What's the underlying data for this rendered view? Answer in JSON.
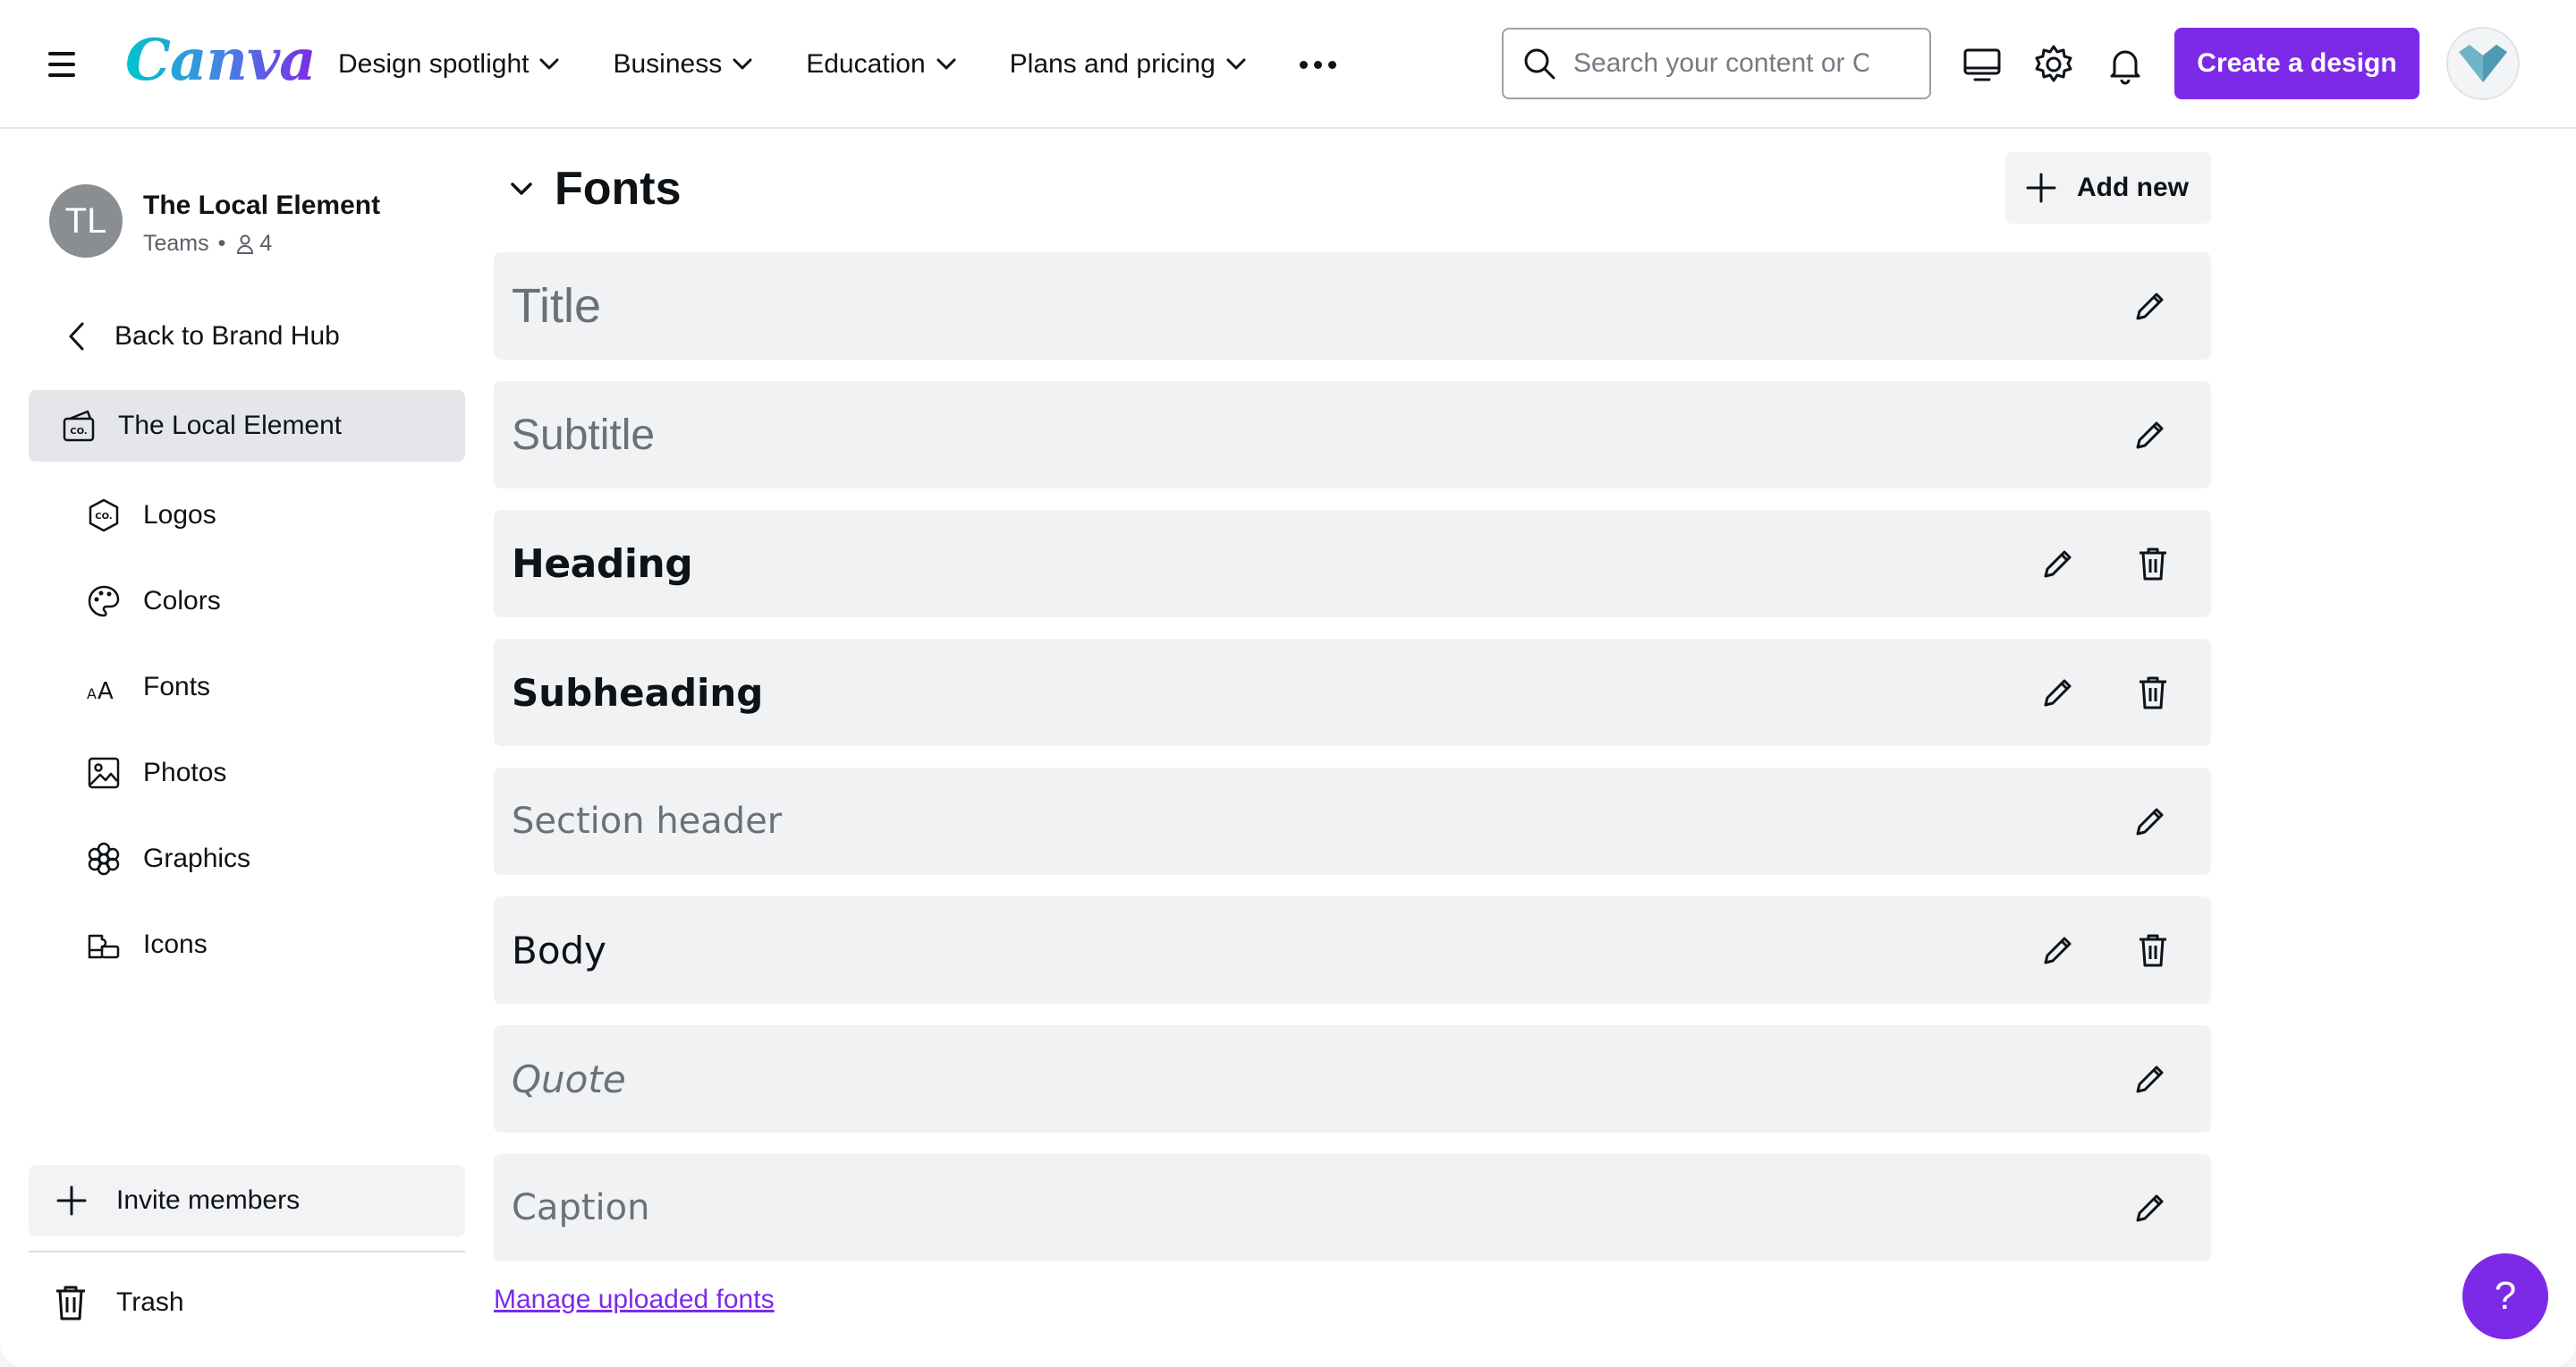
{
  "header": {
    "logo_text": "Canva",
    "nav": [
      {
        "label": "Design spotlight"
      },
      {
        "label": "Business"
      },
      {
        "label": "Education"
      },
      {
        "label": "Plans and pricing"
      }
    ],
    "search_placeholder": "Search your content or Canva's",
    "create_label": "Create a design"
  },
  "sidebar": {
    "team": {
      "initials": "TL",
      "name": "The Local Element",
      "type": "Teams",
      "members": "4"
    },
    "back_label": "Back to Brand Hub",
    "brand_label": "The Local Element",
    "items": [
      {
        "label": "Logos",
        "icon": "logo-badge-icon"
      },
      {
        "label": "Colors",
        "icon": "palette-icon"
      },
      {
        "label": "Fonts",
        "icon": "font-icon"
      },
      {
        "label": "Photos",
        "icon": "photo-icon"
      },
      {
        "label": "Graphics",
        "icon": "flower-icon"
      },
      {
        "label": "Icons",
        "icon": "icon-set-icon"
      }
    ],
    "invite_label": "Invite members",
    "trash_label": "Trash"
  },
  "main": {
    "section_title": "Fonts",
    "add_new_label": "Add new",
    "fonts": [
      {
        "label": "Title",
        "deletable": false
      },
      {
        "label": "Subtitle",
        "deletable": false
      },
      {
        "label": "Heading",
        "deletable": true
      },
      {
        "label": "Subheading",
        "deletable": true
      },
      {
        "label": "Section header",
        "deletable": false
      },
      {
        "label": "Body",
        "deletable": true
      },
      {
        "label": "Quote",
        "deletable": false
      },
      {
        "label": "Caption",
        "deletable": false
      }
    ],
    "manage_link": "Manage uploaded fonts"
  },
  "help_label": "?",
  "colors": {
    "accent": "#7d2ae8",
    "row_bg": "#f1f2f4",
    "selected_bg": "#e5e6ea"
  }
}
